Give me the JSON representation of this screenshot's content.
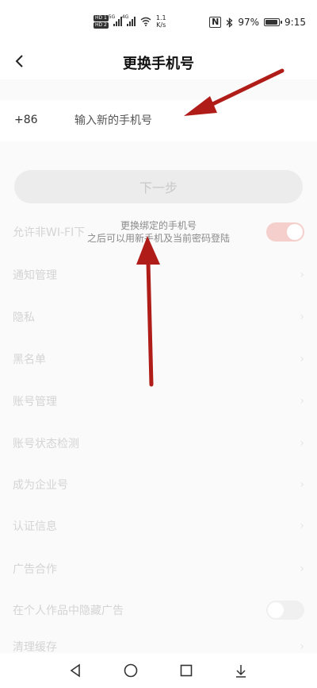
{
  "status_bar": {
    "network_speed_value": "1.1",
    "network_speed_unit": "K/s",
    "battery_percent": "97%",
    "battery_level": 0.97,
    "time": "9:15",
    "sim1_label": "HD 1",
    "sim2_label": "HD 2",
    "sig1_label": "5G",
    "sig2_label": "4G"
  },
  "header": {
    "title": "更换手机号"
  },
  "form": {
    "country_code": "+86",
    "phone_placeholder": "输入新的手机号",
    "next_label": "下一步"
  },
  "tip": {
    "line1": "更换绑定的手机号",
    "line2": "之后可以用新手机及当前密码登陆"
  },
  "background_settings": {
    "items": [
      {
        "label": "允许非WI-FI下"
      },
      {
        "label": "通知管理"
      },
      {
        "label": "隐私"
      },
      {
        "label": "黑名单"
      },
      {
        "label": "账号管理"
      },
      {
        "label": "账号状态检测"
      },
      {
        "label": "成为企业号"
      },
      {
        "label": "认证信息"
      },
      {
        "label": "广告合作"
      },
      {
        "label": "在个人作品中隐藏广告"
      },
      {
        "label": "清理缓存"
      }
    ]
  }
}
